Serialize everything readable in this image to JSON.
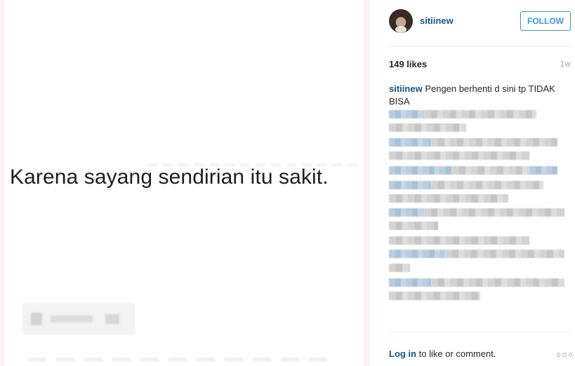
{
  "post": {
    "image_text": "Karena sayang sendirian itu sakit."
  },
  "header": {
    "username": "sitiinew",
    "follow_label": "FOLLOW"
  },
  "stats": {
    "likes": "149 likes",
    "time_ago": "1w"
  },
  "caption": {
    "username": "sitiinew",
    "text": "Pengen berhenti d sini tp TIDAK BISA"
  },
  "comments": {
    "count_pixelated": 7
  },
  "footer": {
    "login_link": "Log in",
    "login_text": " to like or comment."
  },
  "icons": {
    "more": "more-options-icon"
  },
  "colors": {
    "link": "#125688",
    "follow": "#3897f0"
  }
}
